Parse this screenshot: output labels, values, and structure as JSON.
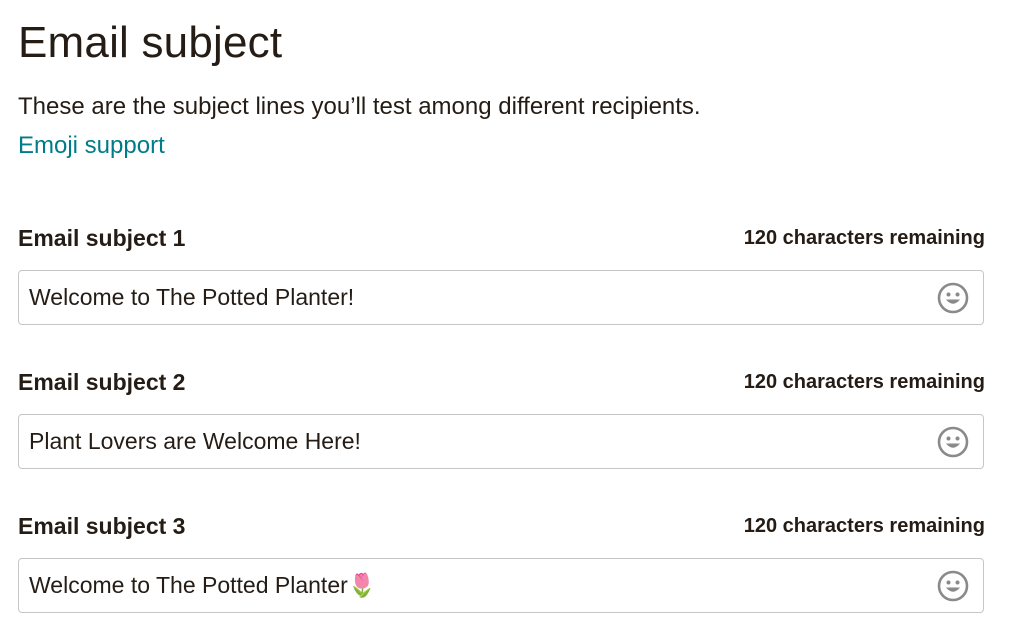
{
  "header": {
    "title": "Email subject",
    "description": "These are the subject lines you’ll test among different recipients.",
    "emoji_link": "Emoji support"
  },
  "fields": [
    {
      "label": "Email subject 1",
      "count": "120 characters remaining",
      "value": "Welcome to The Potted Planter!",
      "icon": "smiley-icon"
    },
    {
      "label": "Email subject 2",
      "count": "120 characters remaining",
      "value": "Plant Lovers are Welcome Here!",
      "icon": "smiley-icon"
    },
    {
      "label": "Email subject 3",
      "count": "120 characters remaining",
      "value": "Welcome to The Potted Planter🌷",
      "icon": "smiley-icon"
    }
  ],
  "colors": {
    "text": "#241c15",
    "link": "#007c89",
    "border": "#c6c6c6",
    "icon": "#8a8a8a"
  }
}
